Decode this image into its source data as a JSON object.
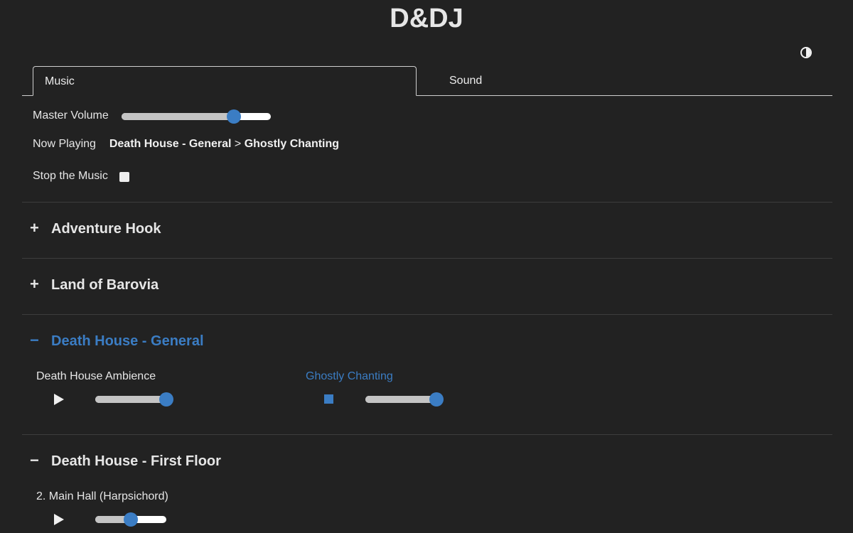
{
  "app": {
    "title": "D&DJ"
  },
  "tabs": [
    {
      "label": "Music",
      "active": true
    },
    {
      "label": "Sound",
      "active": false
    }
  ],
  "controls": {
    "master_volume_label": "Master Volume",
    "master_volume_value": 0.75,
    "now_playing_label": "Now Playing",
    "now_playing_group": "Death House - General",
    "now_playing_separator": ">",
    "now_playing_track": "Ghostly Chanting",
    "stop_label": "Stop the Music"
  },
  "sections": [
    {
      "title": "Adventure Hook",
      "toggle": "+",
      "expanded": false
    },
    {
      "title": "Land of Barovia",
      "toggle": "+",
      "expanded": false
    },
    {
      "title": "Death House - General",
      "toggle": "−",
      "expanded": true,
      "tracks": [
        {
          "title": "Death House Ambience",
          "playing": false,
          "volume": 1.0
        },
        {
          "title": "Ghostly Chanting",
          "playing": true,
          "volume": 1.0
        }
      ]
    },
    {
      "title": "Death House - First Floor",
      "toggle": "−",
      "expanded": true,
      "tracks": [
        {
          "title": "2. Main Hall (Harpsichord)",
          "playing": false,
          "volume": 0.5
        }
      ]
    }
  ],
  "colors": {
    "background": "#222222",
    "accent": "#3b7dc4",
    "text": "#e6e6e6"
  },
  "icons": {
    "theme_toggle": "half-circle-contrast-icon",
    "play": "play-icon",
    "stop": "stop-icon"
  }
}
